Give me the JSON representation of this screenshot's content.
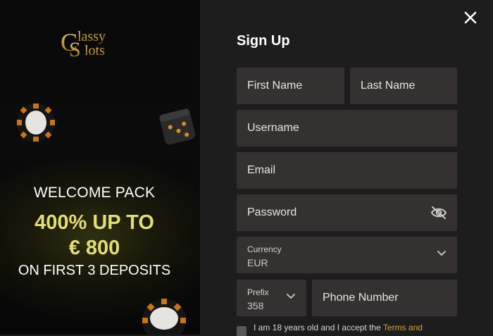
{
  "promo": {
    "line1": "WELCOME PACK",
    "line2": "400% UP TO",
    "line3": "€ 800",
    "line4": "ON FIRST 3 DEPOSITS"
  },
  "logo": {
    "text_top": "lassy",
    "text_bottom": "lots",
    "initial_c": "C",
    "initial_s": "S"
  },
  "form": {
    "title": "Sign Up",
    "first_name_placeholder": "First Name",
    "last_name_placeholder": "Last Name",
    "username_placeholder": "Username",
    "email_placeholder": "Email",
    "password_placeholder": "Password",
    "currency_label": "Currency",
    "currency_value": "EUR",
    "prefix_label": "Prefix",
    "prefix_value": "358",
    "phone_placeholder": "Phone Number",
    "terms_text": "I am 18 years old and I accept the ",
    "terms_link": "Terms and"
  },
  "icons": {
    "close": "close-icon",
    "eye": "eye-slash-icon",
    "chevron": "chevron-down-icon"
  },
  "colors": {
    "accent_gold": "#e3dd7a",
    "field_bg": "#363131",
    "panel_bg": "#1e1d1d",
    "link": "#d9a441"
  }
}
